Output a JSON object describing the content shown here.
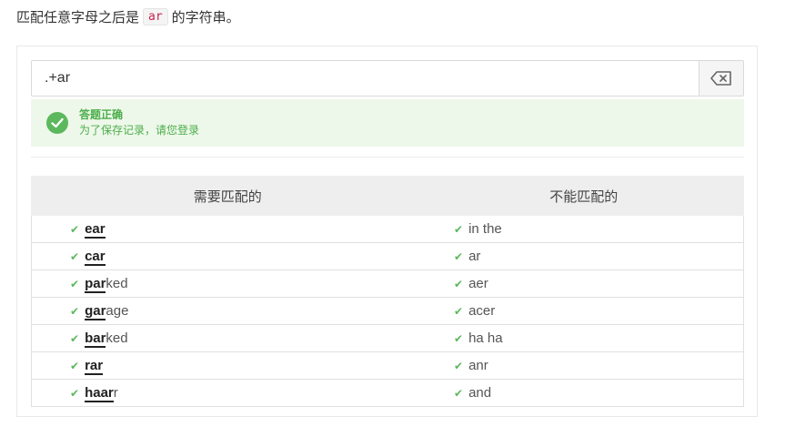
{
  "instruction": {
    "prefix": "匹配任意字母之后是",
    "code": "ar",
    "suffix": "的字符串。"
  },
  "input": {
    "value": ".+ar",
    "clear_icon": "backspace-icon"
  },
  "feedback": {
    "title": "答题正确",
    "subtitle": "为了保存记录，请您登录",
    "icon": "check-circle-icon",
    "color": "#5cb85c"
  },
  "table": {
    "headers": [
      "需要匹配的",
      "不能匹配的"
    ],
    "rows": [
      {
        "match": {
          "hl": "ear",
          "rest": ""
        },
        "nomatch": "in the"
      },
      {
        "match": {
          "hl": "car",
          "rest": ""
        },
        "nomatch": "ar"
      },
      {
        "match": {
          "hl": "par",
          "rest": "ked"
        },
        "nomatch": "aer"
      },
      {
        "match": {
          "hl": "gar",
          "rest": "age"
        },
        "nomatch": "acer"
      },
      {
        "match": {
          "hl": "bar",
          "rest": "ked"
        },
        "nomatch": "ha ha"
      },
      {
        "match": {
          "hl": "rar",
          "rest": ""
        },
        "nomatch": "anr"
      },
      {
        "match": {
          "hl": "haar",
          "rest": "r"
        },
        "nomatch": "and"
      }
    ]
  }
}
